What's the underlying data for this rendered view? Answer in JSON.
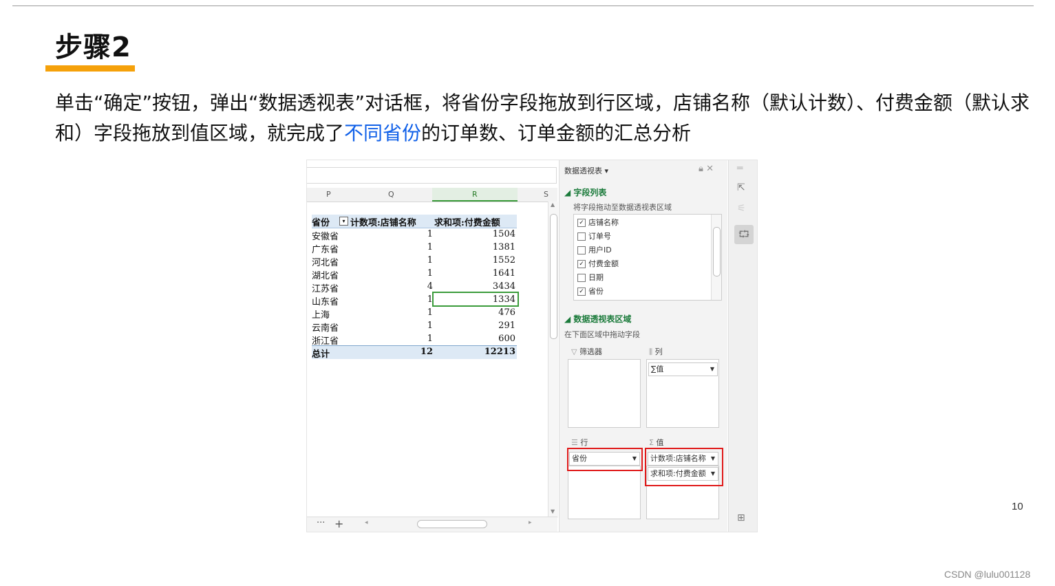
{
  "slide": {
    "title": "步骤2",
    "para_part1": "单击“确定”按钮，弹出“数据透视表”对话框，将省份字段拖放到行区域，店铺名称（默认计数）、付费金额（默认求和）字段拖放到值区域，就完成了",
    "para_highlight": "不同省份",
    "para_part2": "的订单数、订单金额的汇总分析",
    "page_number": "10",
    "watermark": "CSDN @lulu001128",
    "colors": {
      "title_bar": "#f5a10a",
      "highlight": "#1060e8",
      "callout": "#e01a1a"
    }
  },
  "sheet": {
    "columns": [
      "P",
      "Q",
      "R",
      "S"
    ],
    "header": {
      "col1": "省份",
      "col2": "计数项:店铺名称",
      "col3": "求和项:付费金额"
    },
    "rows": [
      {
        "province": "安徽省",
        "count": "1",
        "sum": "1504"
      },
      {
        "province": "广东省",
        "count": "1",
        "sum": "1381"
      },
      {
        "province": "河北省",
        "count": "1",
        "sum": "1552"
      },
      {
        "province": "湖北省",
        "count": "1",
        "sum": "1641"
      },
      {
        "province": "江苏省",
        "count": "4",
        "sum": "3434"
      },
      {
        "province": "山东省",
        "count": "1",
        "sum": "1334"
      },
      {
        "province": "上海",
        "count": "1",
        "sum": "476"
      },
      {
        "province": "云南省",
        "count": "1",
        "sum": "291"
      },
      {
        "province": "浙江省",
        "count": "1",
        "sum": "600"
      }
    ],
    "total": {
      "label": "总计",
      "count": "12",
      "sum": "12213"
    },
    "bottom": {
      "more": "···",
      "add": "+"
    }
  },
  "pane": {
    "title": "数据透视表",
    "field_section": "字段列表",
    "field_hint": "将字段拖动至数据透视表区域",
    "fields": [
      {
        "label": "店铺名称",
        "checked": true
      },
      {
        "label": "订单号",
        "checked": false
      },
      {
        "label": "用户ID",
        "checked": false
      },
      {
        "label": "付费金额",
        "checked": true
      },
      {
        "label": "日期",
        "checked": false
      },
      {
        "label": "省份",
        "checked": true
      }
    ],
    "area_section": "数据透视表区域",
    "area_hint": "在下面区域中拖动字段",
    "filter_label": "筛选器",
    "column_label": "列",
    "row_label": "行",
    "value_label": "值",
    "column_chip": "∑值",
    "row_chip": "省份",
    "value_chips": [
      "计数项:店铺名称",
      "求和项:付费金额"
    ]
  }
}
